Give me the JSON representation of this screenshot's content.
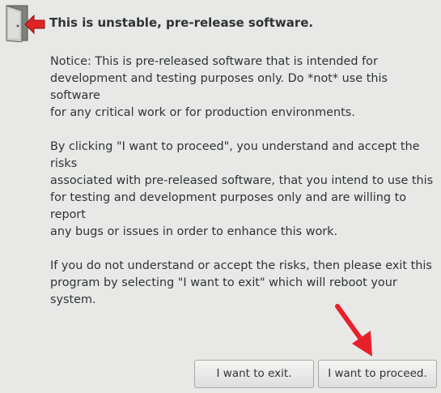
{
  "dialog": {
    "title": "This is unstable, pre-release software.",
    "paragraphs": [
      "Notice: This is pre-released software that is intended for\ndevelopment and testing purposes only.  Do *not* use this software\nfor any critical work or for production environments.",
      "By clicking \"I want to proceed\", you understand and accept the risks\nassociated with pre-released software, that you intend to use this\nfor testing and development purposes only and are willing to report\nany bugs or issues in order to enhance this work.",
      "If you do not understand or accept the risks, then please exit this\nprogram by selecting \"I want to exit\" which will reboot your system."
    ],
    "icon": "exit-door-icon",
    "arrow_annotation_color": "#e8202a"
  },
  "buttons": {
    "exit_label": "I want to exit.",
    "proceed_label": "I want to proceed."
  }
}
